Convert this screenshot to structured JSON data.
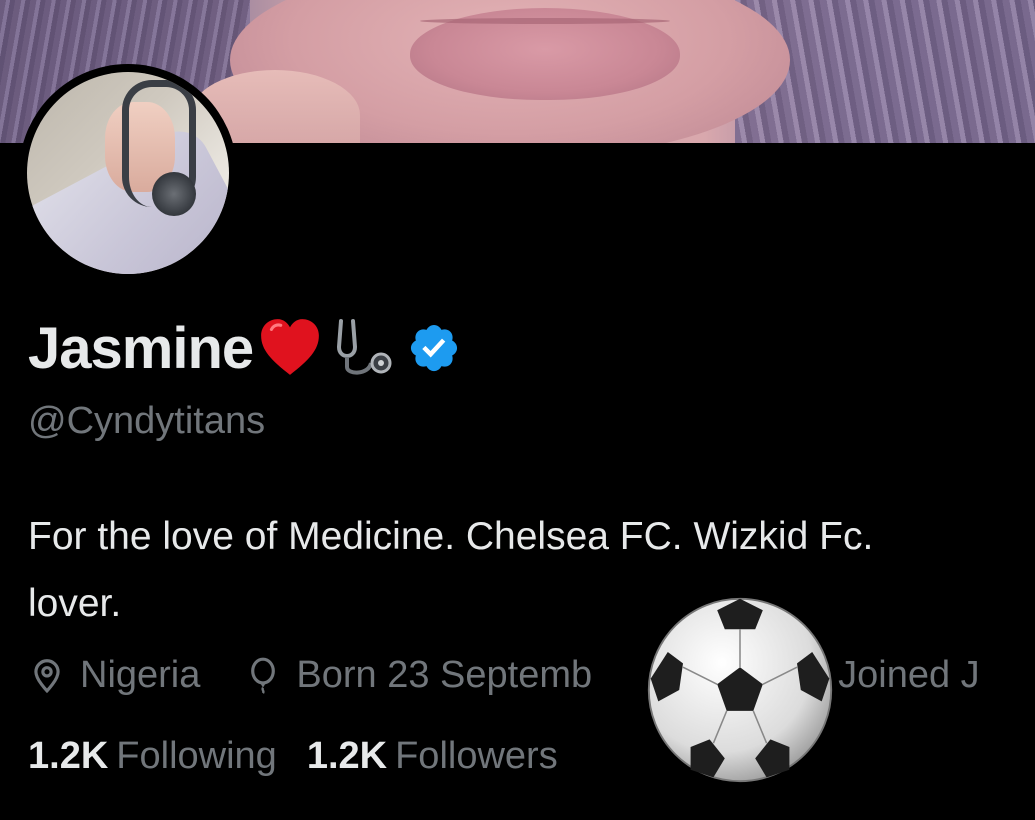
{
  "profile": {
    "name": "Jasmine",
    "name_emojis": [
      "red-heart-emoji",
      "stethoscope-emoji"
    ],
    "verified": true,
    "handle": "@Cyndytitans",
    "bio": {
      "line1": "For the love of Medicine. Chelsea FC. Wizkid Fc.",
      "line2": "lover."
    },
    "meta": {
      "location": "Nigeria",
      "birthday": "Born 23 Septemb",
      "joined": "Joined J"
    },
    "stats": {
      "following_count": "1.2K",
      "following_label": "Following",
      "followers_count": "1.2K",
      "followers_label": "Followers"
    }
  },
  "colors": {
    "background": "#000000",
    "primary_text": "#e7e9ea",
    "secondary_text": "#71767b",
    "verified_blue": "#1d9bf0",
    "heart_red": "#e0121e"
  },
  "icons": [
    "location-icon",
    "balloon-icon",
    "calendar-icon",
    "verified-badge-icon",
    "soccer-ball-emoji"
  ]
}
